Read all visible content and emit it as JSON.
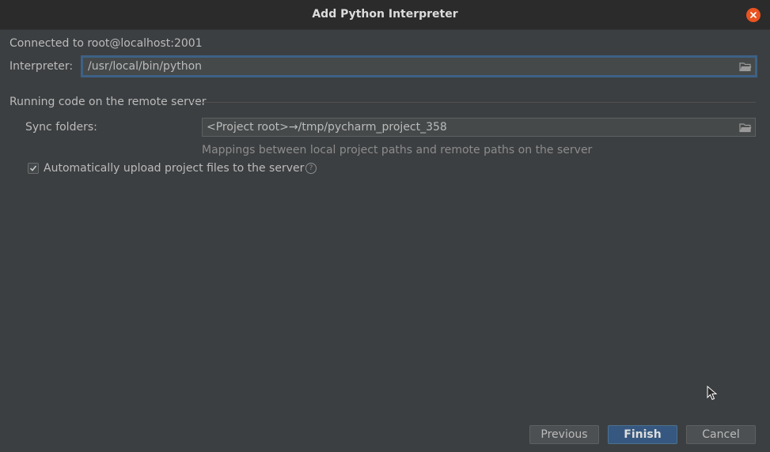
{
  "window": {
    "title": "Add Python Interpreter"
  },
  "connection": {
    "text": "Connected to root@localhost:2001"
  },
  "interpreter": {
    "label": "Interpreter:",
    "value": "/usr/local/bin/python"
  },
  "section": {
    "title": "Running code on the remote server"
  },
  "sync": {
    "label": "Sync folders:",
    "value": "<Project root>→/tmp/pycharm_project_358",
    "hint": "Mappings between local project paths and remote paths on the server"
  },
  "upload": {
    "label": "Automatically upload project files to the server",
    "checked": true,
    "help_glyph": "?"
  },
  "buttons": {
    "previous": "Previous",
    "finish": "Finish",
    "cancel": "Cancel"
  },
  "icons": {
    "close": "close-icon",
    "folder": "folder-icon",
    "help": "help-icon",
    "check": "checkmark-icon",
    "cursor": "mouse-cursor-icon"
  },
  "colors": {
    "background": "#3c3f41",
    "titlebar": "#2b2b2b",
    "close_button": "#e95420",
    "focus_border": "#3d6185",
    "primary_button": "#365880"
  }
}
